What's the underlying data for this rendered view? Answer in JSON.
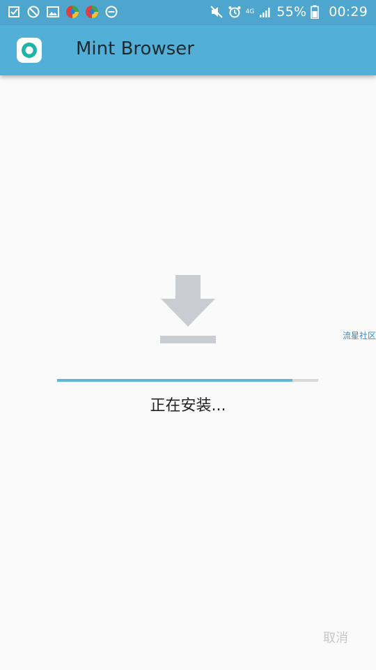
{
  "status_bar": {
    "battery": "55%",
    "time": "00:29",
    "network": "4G",
    "icons_left": [
      "tasks-icon",
      "blocked-icon",
      "gallery-icon",
      "app-badge-icon",
      "app-badge-icon",
      "dnd-icon"
    ],
    "icons_right": [
      "mute-icon",
      "alarm-icon",
      "signal-icon",
      "battery-icon"
    ]
  },
  "app_bar": {
    "title": "Mint Browser",
    "logo": "mint-browser-logo"
  },
  "side_link": "流星社区",
  "install": {
    "progress": 0.9,
    "status_text": "正在安装..."
  },
  "actions": {
    "cancel_label": "取消"
  },
  "colors": {
    "status_bar": "#4ea6cf",
    "app_bar": "#52b0d8",
    "progress_fill": "#5fb6db",
    "progress_track": "#d9d9d9",
    "download_icon": "#c9cdd2"
  }
}
